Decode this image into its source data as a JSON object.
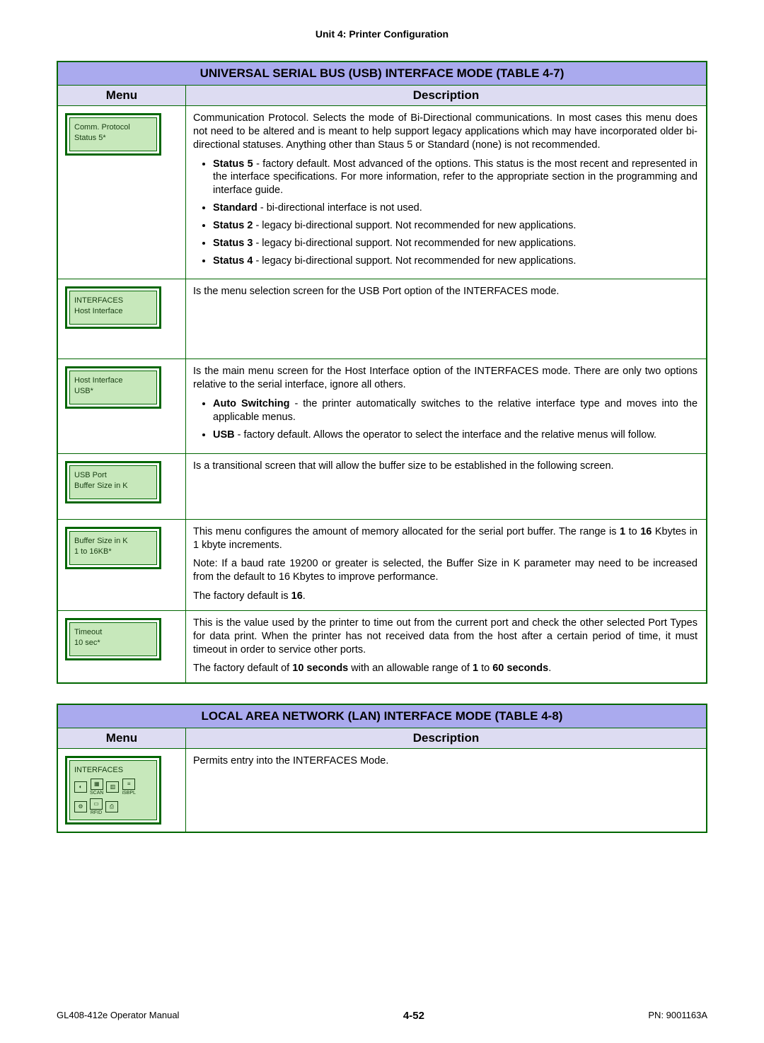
{
  "header": {
    "unit": "Unit 4:  Printer Configuration"
  },
  "table_usb": {
    "title": "UNIVERSAL SERIAL BUS (USB) INTERFACE MODE (TABLE 4-7)",
    "col_menu": "Menu",
    "col_desc": "Description",
    "rows": [
      {
        "lcd": {
          "line1": "Comm. Protocol",
          "line2": "Status 5*"
        },
        "desc": {
          "intro": "Communication Protocol. Selects the mode of Bi-Directional communications. In most cases this menu does not need to be altered and is meant to help support legacy applications which may have incorporated older bi-directional statuses. Anything other than Staus 5 or Standard (none) is not recommended.",
          "bullets": [
            {
              "bold": "Status 5",
              "rest": " - factory default. Most advanced of the options. This status is the most recent and represented in the interface specifications. For more information, refer to the appropriate section in the programming and interface guide."
            },
            {
              "bold": "Standard",
              "rest": " - bi-directional interface is not used."
            },
            {
              "bold": "Status 2",
              "rest": " - legacy bi-directional support. Not recommended for new applications."
            },
            {
              "bold": "Status 3",
              "rest": " - legacy bi-directional support. Not recommended for new applications."
            },
            {
              "bold": "Status 4",
              "rest": " - legacy bi-directional support. Not recommended for new applications."
            }
          ]
        }
      },
      {
        "lcd": {
          "line1": "INTERFACES",
          "line2": "Host Interface"
        },
        "desc": {
          "p1": "Is the menu selection screen for the USB Port option of the INTERFACES mode."
        }
      },
      {
        "lcd": {
          "line1": "Host Interface",
          "line2": "USB*"
        },
        "desc": {
          "intro": "Is the main menu screen for the Host Interface option of the INTERFACES mode. There are only two options relative to the serial interface, ignore all others.",
          "bullets": [
            {
              "bold": "Auto Switching",
              "rest": " - the printer automatically switches to the relative interface type and moves into the applicable menus."
            },
            {
              "bold": "USB",
              "rest": " - factory default. Allows the operator to select the interface and the relative menus will follow."
            }
          ]
        }
      },
      {
        "lcd": {
          "line1": "USB Port",
          "line2": "Buffer Size in K"
        },
        "desc": {
          "p1": "Is a transitional screen that will allow the buffer size to be established in the following screen."
        }
      },
      {
        "lcd": {
          "line1": "Buffer Size in K",
          "line2": "1 to 16KB*"
        },
        "desc": {
          "p1_a": "This menu configures the amount of memory allocated for the serial port buffer. The range is ",
          "p1_bold1": "1",
          "p1_b": " to ",
          "p1_bold2": "16",
          "p1_c": " Kbytes in 1 kbyte increments.",
          "p2": "Note: If a baud rate 19200 or greater is selected, the Buffer Size in K parameter may need to be increased from the default to 16 Kbytes to improve performance.",
          "p3_a": "The factory default is ",
          "p3_bold": "16",
          "p3_b": "."
        }
      },
      {
        "lcd": {
          "line1": "Timeout",
          "line2": "10 sec*"
        },
        "desc": {
          "p1": "This is the value used by the printer to time out from the current port and check the other selected Port Types for data print. When the printer has not received data from the host after a certain period of time, it must timeout in order to service other ports.",
          "p2_a": "The factory default of ",
          "p2_bold1": "10 seconds",
          "p2_b": " with an allowable range of ",
          "p2_bold2": "1",
          "p2_c": " to ",
          "p2_bold3": "60 seconds",
          "p2_d": "."
        }
      }
    ]
  },
  "table_lan": {
    "title": "LOCAL AREA NETWORK (LAN) INTERFACE MODE (TABLE 4-8)",
    "col_menu": "Menu",
    "col_desc": "Description",
    "rows": [
      {
        "lcd": {
          "line1": "INTERFACES"
        },
        "desc": {
          "p1": "Permits entry into the INTERFACES Mode."
        },
        "icons": {
          "labels": [
            "SCAN",
            "RFID",
            "iSBPL"
          ]
        }
      }
    ]
  },
  "footer": {
    "left": "GL408-412e Operator Manual",
    "center": "4-52",
    "right": "PN: 9001163A"
  }
}
